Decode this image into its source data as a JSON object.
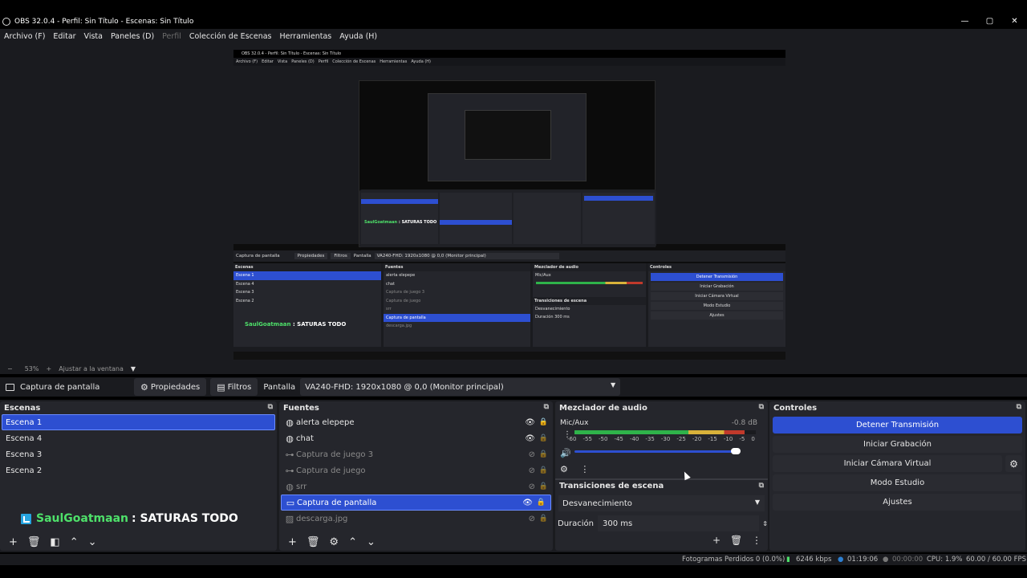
{
  "window": {
    "title": "OBS 32.0.4 - Perfil: Sin Título - Escenas: Sin Título",
    "controls": [
      "—",
      "▢",
      "✕"
    ]
  },
  "menu": [
    {
      "label": "Archivo (F)",
      "disabled": false
    },
    {
      "label": "Editar",
      "disabled": false
    },
    {
      "label": "Vista",
      "disabled": false
    },
    {
      "label": "Paneles (D)",
      "disabled": false
    },
    {
      "label": "Perfil",
      "disabled": true
    },
    {
      "label": "Colección de Escenas",
      "disabled": false
    },
    {
      "label": "Herramientas",
      "disabled": false
    },
    {
      "label": "Ayuda (H)",
      "disabled": false
    }
  ],
  "zoom": {
    "minus": "−",
    "value": "53%",
    "plus": "+",
    "fit": "Ajustar a la ventana",
    "arrow": "▼"
  },
  "context": {
    "source": "Captura de pantalla",
    "properties": "Propiedades",
    "filters": "Filtros",
    "display_label": "Pantalla",
    "display_value": "VA240-FHD: 1920x1080 @ 0,0 (Monitor principal)"
  },
  "scenes": {
    "title": "Escenas",
    "items": [
      "Escena 1",
      "Escena 4",
      "Escena 3",
      "Escena 2"
    ],
    "selected_index": 0,
    "brand_logo": "SaulGoatmaan",
    "brand_text": ": SATURAS TODO"
  },
  "sources": {
    "title": "Fuentes",
    "items": [
      {
        "name": "alerta elepepe",
        "icon": "globe-icon",
        "glyph": "◍",
        "visible": true
      },
      {
        "name": "chat",
        "icon": "globe-icon",
        "glyph": "◍",
        "visible": true
      },
      {
        "name": "Captura de juego 3",
        "icon": "gamepad-icon",
        "glyph": "⊶",
        "visible": false
      },
      {
        "name": "Captura de juego",
        "icon": "gamepad-icon",
        "glyph": "⊶",
        "visible": false
      },
      {
        "name": "srr",
        "icon": "globe-icon",
        "glyph": "◍",
        "visible": false
      },
      {
        "name": "Captura de pantalla",
        "icon": "monitor-icon",
        "glyph": "▭",
        "visible": true
      },
      {
        "name": "descarga.jpg",
        "icon": "image-icon",
        "glyph": "▨",
        "visible": false
      }
    ],
    "selected_index": 5
  },
  "mixer": {
    "title": "Mezclador de audio",
    "channel": "Mic/Aux",
    "db": "-0.8 dB",
    "level": 0.94,
    "volume": 0.95,
    "ticks": [
      "-60",
      "-55",
      "-50",
      "-45",
      "-40",
      "-35",
      "-30",
      "-25",
      "-20",
      "-15",
      "-10",
      "-5",
      "0"
    ]
  },
  "transitions": {
    "title": "Transiciones de escena",
    "selected": "Desvanecimiento",
    "duration_label": "Duración",
    "duration_value": "300 ms"
  },
  "controls": {
    "title": "Controles",
    "stop_stream": "Detener Transmisión",
    "start_recording": "Iniciar Grabación",
    "start_virtual_cam": "Iniciar Cámara Virtual",
    "studio_mode": "Modo Estudio",
    "settings": "Ajustes"
  },
  "status": {
    "dropped": "Fotogramas Perdidos 0 (0.0%)",
    "bitrate": "6246 kbps",
    "stream_time": "01:19:06",
    "rec_time": "00:00:00",
    "cpu": "CPU: 1.9%",
    "fps": "60.00 / 60.00 FPS"
  },
  "colors": {
    "accent": "#2d4fd1",
    "panel": "#25262c",
    "background": "#1a1b1f",
    "meter_green": "#2fb34a",
    "meter_yellow": "#d9b23a",
    "meter_red": "#c0392b"
  }
}
